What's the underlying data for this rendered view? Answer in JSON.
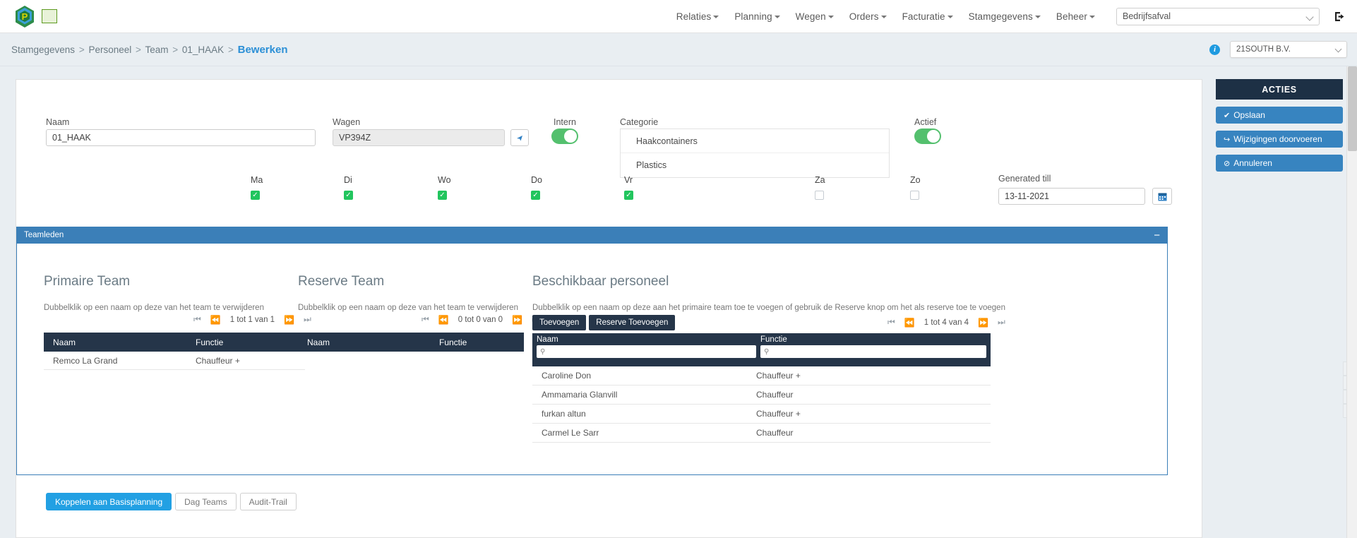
{
  "navbar": {
    "logo_name": "app-logo",
    "menu": [
      {
        "label": "Relaties",
        "has_caret": true
      },
      {
        "label": "Planning",
        "has_caret": true
      },
      {
        "label": "Wegen",
        "has_caret": true
      },
      {
        "label": "Orders",
        "has_caret": true
      },
      {
        "label": "Facturatie",
        "has_caret": true
      },
      {
        "label": "Stamgegevens",
        "has_caret": true
      },
      {
        "label": "Beheer",
        "has_caret": true
      }
    ],
    "company_select": "Bedrijfsafval",
    "logout_icon": "logout-icon"
  },
  "breadcrumb": {
    "part1": "Stamgegevens",
    "part2": "Personeel",
    "part3": "Team",
    "part4": "01_HAAK",
    "current": "Bewerken",
    "separator": ">",
    "info_icon": "i",
    "branch_select": "21SOUTH B.V."
  },
  "actions": {
    "title": "ACTIES",
    "buttons": [
      {
        "label": "Opslaan",
        "icon": "✔"
      },
      {
        "label": "Wijzigingen doorvoeren",
        "icon": "↪"
      },
      {
        "label": "Annuleren",
        "icon": "⊘"
      }
    ]
  },
  "form": {
    "naam_label": "Naam",
    "naam_value": "01_HAAK",
    "wagen_label": "Wagen",
    "wagen_value": "VP394Z",
    "wagen_btn_icon": "✈",
    "intern_label": "Intern",
    "intern_on": true,
    "categorie_label": "Categorie",
    "categorie_items": [
      "Haakcontainers",
      "Plastics"
    ],
    "actief_label": "Actief",
    "actief_on": true,
    "generated_till_label": "Generated till",
    "generated_till_value": "13-11-2021",
    "calendar_icon": "Ὄ5"
  },
  "days": [
    {
      "label": "Ma",
      "checked": true
    },
    {
      "label": "Di",
      "checked": true
    },
    {
      "label": "Wo",
      "checked": true
    },
    {
      "label": "Do",
      "checked": true
    },
    {
      "label": "Vr",
      "checked": true
    },
    {
      "label": "Za",
      "checked": false
    },
    {
      "label": "Zo",
      "checked": false
    }
  ],
  "panel": {
    "title": "Teamleden",
    "collapse_icon": "−"
  },
  "primaire_team": {
    "title": "Primaire Team",
    "hint": "Dubbelklik op een naam op deze van het team te verwijderen",
    "pager": "1 tot 1 van 1",
    "columns": [
      "Naam",
      "Functie"
    ],
    "rows": [
      {
        "naam": "Remco La Grand",
        "functie": "Chauffeur +"
      }
    ]
  },
  "reserve_team": {
    "title": "Reserve Team",
    "hint": "Dubbelklik op een naam op deze van het team te verwijderen",
    "pager": "0 tot 0 van 0",
    "columns": [
      "Naam",
      "Functie"
    ],
    "rows": []
  },
  "beschikbaar": {
    "title": "Beschikbaar personeel",
    "hint": "Dubbelklik op een naam op deze aan het primaire team toe te voegen of gebruik de Reserve knop om het als reserve toe te voegen",
    "btn_toevoegen": "Toevoegen",
    "btn_reserve_toevoegen": "Reserve Toevoegen",
    "pager": "1 tot 4 van 4",
    "columns": [
      "Naam",
      "Functie"
    ],
    "search_icon": "⚲",
    "search_naam": "",
    "search_functie": "",
    "rows": [
      {
        "naam": "Caroline Don",
        "functie": "Chauffeur +"
      },
      {
        "naam": "Ammamaria Glanvill",
        "functie": "Chauffeur"
      },
      {
        "naam": "furkan altun",
        "functie": "Chauffeur +"
      },
      {
        "naam": "Carmel Le Sarr",
        "functie": "Chauffeur"
      }
    ]
  },
  "bottom_buttons": [
    {
      "label": "Koppelen aan Basisplanning",
      "primary": true
    },
    {
      "label": "Dag Teams",
      "primary": false
    },
    {
      "label": "Audit-Trail",
      "primary": false
    }
  ],
  "edge_tools": [
    {
      "name": "chat-icon",
      "glyph": "✉"
    },
    {
      "name": "edit-icon",
      "glyph": "✎"
    },
    {
      "name": "copy-icon",
      "glyph": "❐"
    },
    {
      "name": "share-icon",
      "glyph": "❖"
    }
  ],
  "pager_icons": {
    "first": "⏮",
    "prev": "⏪",
    "next": "⏩",
    "last": "⏭"
  },
  "colors": {
    "accent_blue": "#3784c0",
    "dark_navy": "#253549",
    "panel_blue": "#3b7fb8",
    "green": "#54c06e",
    "link_blue": "#2b8fd6"
  }
}
